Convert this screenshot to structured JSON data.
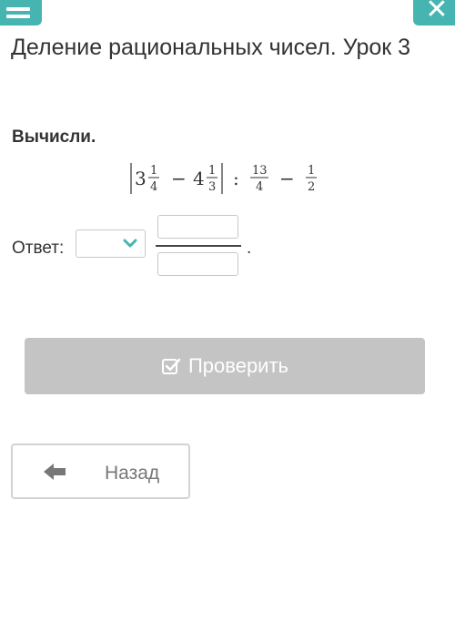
{
  "header": {
    "menu_icon": "hamburger-icon",
    "close_icon": "close-icon",
    "accent_color": "#46b5b1"
  },
  "lesson": {
    "title": "Деление рациональных чисел. Урок 3"
  },
  "task": {
    "prompt": "Вычисли.",
    "expression": {
      "mixed1_whole": "3",
      "mixed1_num": "1",
      "mixed1_den": "4",
      "op1": "−",
      "mixed2_whole": "4",
      "mixed2_num": "1",
      "mixed2_den": "3",
      "op2": ":",
      "frac1_num": "13",
      "frac1_den": "4",
      "op3": "−",
      "frac2_num": "1",
      "frac2_den": "2"
    }
  },
  "answer": {
    "label": "Ответ:",
    "sign_select_value": "",
    "numerator_value": "",
    "denominator_value": "",
    "end_punct": "."
  },
  "buttons": {
    "check_label": "Проверить",
    "check_icon": "checkbox-icon",
    "back_label": "Назад",
    "back_icon": "arrow-left-icon"
  }
}
